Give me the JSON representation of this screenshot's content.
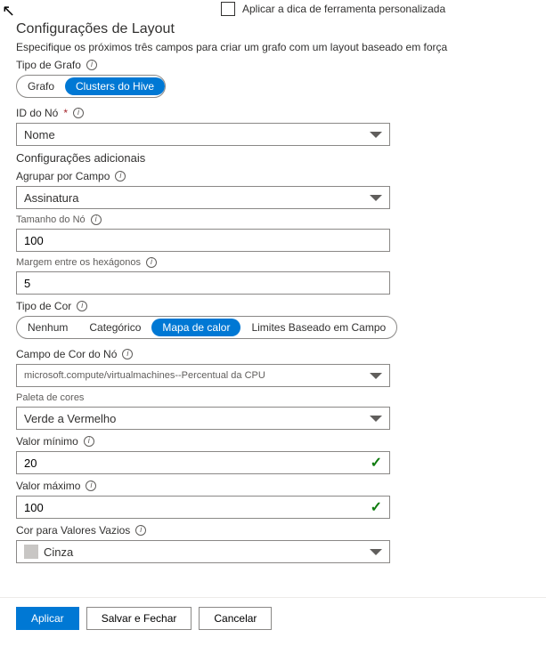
{
  "tooltip_checkbox_label": "Aplicar a dica de ferramenta personalizada",
  "layout_title": "Configurações de Layout",
  "layout_hint": "Especifique os próximos três campos para criar um grafo com um layout baseado em força",
  "graph_type": {
    "label": "Tipo de Grafo",
    "options": [
      "Grafo",
      "Clusters do Hive"
    ],
    "selected": "Clusters do Hive"
  },
  "node_id": {
    "label": "ID do Nó",
    "required": "*",
    "value": "Nome"
  },
  "additional_title": "Configurações adicionais",
  "group_by": {
    "label": "Agrupar por Campo",
    "value": "Assinatura"
  },
  "node_size": {
    "label": "Tamanho do Nó",
    "value": "100"
  },
  "hex_margin": {
    "label": "Margem entre os hexágonos",
    "value": "5"
  },
  "color_type": {
    "label": "Tipo de Cor",
    "options": [
      "Nenhum",
      "Categórico",
      "Mapa de calor",
      "Limites Baseado em Campo"
    ],
    "selected": "Mapa de calor"
  },
  "color_field": {
    "label": "Campo de Cor do Nó",
    "value": "microsoft.compute/virtualmachines--Percentual da CPU"
  },
  "palette": {
    "label": "Paleta de cores",
    "value": "Verde a Vermelho"
  },
  "min_value": {
    "label": "Valor mínimo",
    "value": "20"
  },
  "max_value": {
    "label": "Valor máximo",
    "value": "100"
  },
  "empty_color": {
    "label": "Cor para Valores Vazios",
    "value": "Cinza"
  },
  "buttons": {
    "apply": "Aplicar",
    "save_close": "Salvar e Fechar",
    "cancel": "Cancelar"
  }
}
